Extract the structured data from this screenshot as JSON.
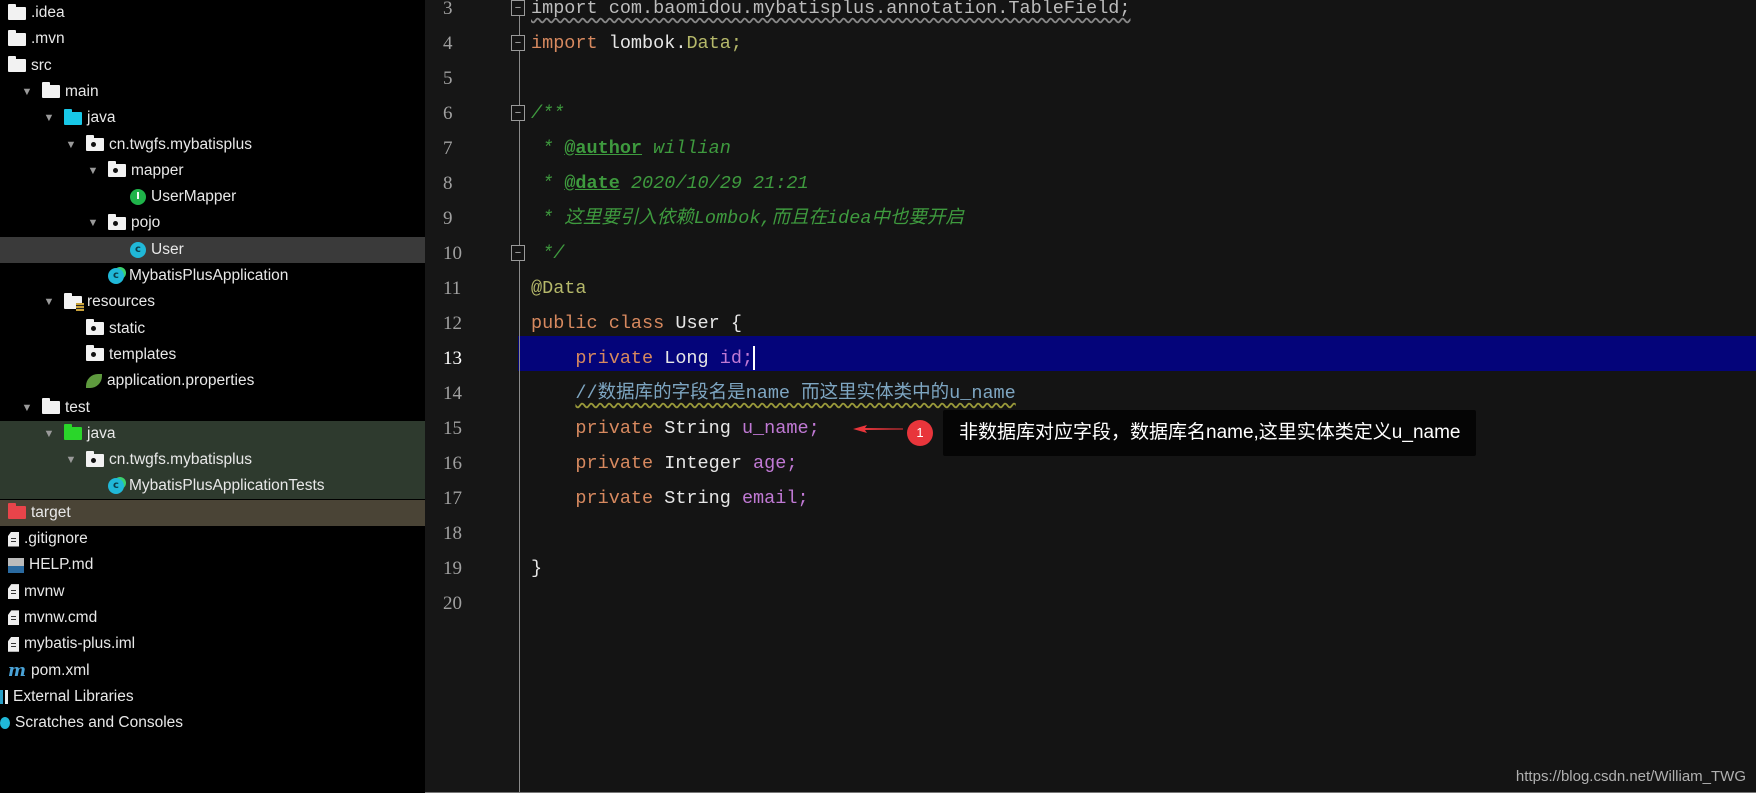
{
  "project_tree": {
    "items": [
      {
        "label": ".idea",
        "indent": 0,
        "toggle": "none",
        "icon": "folder-icon",
        "state": ""
      },
      {
        "label": ".mvn",
        "indent": 0,
        "toggle": "none",
        "icon": "folder-icon",
        "state": ""
      },
      {
        "label": "src",
        "indent": 0,
        "toggle": "none",
        "icon": "folder-icon",
        "state": ""
      },
      {
        "label": "main",
        "indent": 1,
        "toggle": "expanded",
        "icon": "folder-icon",
        "state": ""
      },
      {
        "label": "java",
        "indent": 2,
        "toggle": "expanded",
        "icon": "source-folder-icon",
        "state": ""
      },
      {
        "label": "cn.twgfs.mybatisplus",
        "indent": 3,
        "toggle": "expanded",
        "icon": "package-icon",
        "state": ""
      },
      {
        "label": "mapper",
        "indent": 4,
        "toggle": "expanded",
        "icon": "package-icon",
        "state": ""
      },
      {
        "label": "UserMapper",
        "indent": 5,
        "toggle": "none",
        "icon": "interface-icon",
        "state": ""
      },
      {
        "label": "pojo",
        "indent": 4,
        "toggle": "expanded",
        "icon": "package-icon",
        "state": ""
      },
      {
        "label": "User",
        "indent": 5,
        "toggle": "none",
        "icon": "class-icon",
        "state": "selected"
      },
      {
        "label": "MybatisPlusApplication",
        "indent": 4,
        "toggle": "none",
        "icon": "spring-boot-class-icon",
        "state": ""
      },
      {
        "label": "resources",
        "indent": 2,
        "toggle": "expanded",
        "icon": "resources-folder-icon",
        "state": ""
      },
      {
        "label": "static",
        "indent": 3,
        "toggle": "none",
        "icon": "package-icon",
        "state": ""
      },
      {
        "label": "templates",
        "indent": 3,
        "toggle": "none",
        "icon": "package-icon",
        "state": ""
      },
      {
        "label": "application.properties",
        "indent": 3,
        "toggle": "none",
        "icon": "spring-properties-icon",
        "state": ""
      },
      {
        "label": "test",
        "indent": 1,
        "toggle": "expanded",
        "icon": "folder-icon",
        "state": ""
      },
      {
        "label": "java",
        "indent": 2,
        "toggle": "expanded",
        "icon": "test-folder-icon",
        "state": "test"
      },
      {
        "label": "cn.twgfs.mybatisplus",
        "indent": 3,
        "toggle": "expanded",
        "icon": "package-icon",
        "state": "test"
      },
      {
        "label": "MybatisPlusApplicationTests",
        "indent": 4,
        "toggle": "none",
        "icon": "spring-boot-class-icon",
        "state": "test"
      },
      {
        "label": "target",
        "indent": 0,
        "toggle": "none",
        "icon": "excluded-folder-icon",
        "state": "excluded"
      },
      {
        "label": ".gitignore",
        "indent": 0,
        "toggle": "none",
        "icon": "text-file-icon",
        "state": ""
      },
      {
        "label": "HELP.md",
        "indent": 0,
        "toggle": "none",
        "icon": "markdown-file-icon",
        "state": ""
      },
      {
        "label": "mvnw",
        "indent": 0,
        "toggle": "none",
        "icon": "text-file-icon",
        "state": ""
      },
      {
        "label": "mvnw.cmd",
        "indent": 0,
        "toggle": "none",
        "icon": "text-file-icon",
        "state": ""
      },
      {
        "label": "mybatis-plus.iml",
        "indent": 0,
        "toggle": "none",
        "icon": "module-file-icon",
        "state": ""
      },
      {
        "label": "pom.xml",
        "indent": 0,
        "toggle": "none",
        "icon": "maven-icon",
        "state": ""
      },
      {
        "label": "External Libraries",
        "indent": -1,
        "toggle": "none",
        "icon": "external-libraries-icon",
        "state": ""
      },
      {
        "label": "Scratches and Consoles",
        "indent": -1,
        "toggle": "none",
        "icon": "scratches-icon",
        "state": ""
      }
    ]
  },
  "editor": {
    "current_line": 13,
    "lines": [
      {
        "n": "3",
        "tokens": [
          {
            "t": "import com.baomidou.mybatisplus.annotation.TableField;",
            "c": "unused"
          }
        ],
        "fold": "open"
      },
      {
        "n": "4",
        "tokens": [
          {
            "t": "import",
            "c": "kw"
          },
          {
            "t": " lombok.",
            "c": ""
          },
          {
            "t": "Data;",
            "c": "ann"
          }
        ],
        "fold": "close"
      },
      {
        "n": "5",
        "tokens": []
      },
      {
        "n": "6",
        "tokens": [
          {
            "t": "/**",
            "c": "cmt"
          }
        ],
        "fold": "open"
      },
      {
        "n": "7",
        "tokens": [
          {
            "t": " * ",
            "c": "cmt"
          },
          {
            "t": "@author",
            "c": "cmt-tag"
          },
          {
            "t": " willian",
            "c": "cmt"
          }
        ]
      },
      {
        "n": "8",
        "tokens": [
          {
            "t": " * ",
            "c": "cmt"
          },
          {
            "t": "@date",
            "c": "cmt-tag"
          },
          {
            "t": " 2020/10/29 21:21",
            "c": "cmt"
          }
        ]
      },
      {
        "n": "9",
        "tokens": [
          {
            "t": " * 这里要引入依赖Lombok,而且在idea中也要开启",
            "c": "cmt"
          }
        ]
      },
      {
        "n": "10",
        "tokens": [
          {
            "t": " */",
            "c": "cmt"
          }
        ],
        "fold": "close"
      },
      {
        "n": "11",
        "tokens": [
          {
            "t": "@Data",
            "c": "ann"
          }
        ]
      },
      {
        "n": "12",
        "tokens": [
          {
            "t": "public class",
            "c": "kw"
          },
          {
            "t": " User {",
            "c": ""
          }
        ]
      },
      {
        "n": "13",
        "tokens": [
          {
            "t": "    private",
            "c": "kw"
          },
          {
            "t": " Long ",
            "c": ""
          },
          {
            "t": "id;",
            "c": "fld"
          }
        ],
        "caret": true
      },
      {
        "n": "14",
        "tokens": [
          {
            "t": "    ",
            "c": ""
          },
          {
            "t": "//数据库的字段名是name 而这里实体类中的u_name",
            "c": "lcmt"
          }
        ]
      },
      {
        "n": "15",
        "tokens": [
          {
            "t": "    private",
            "c": "kw"
          },
          {
            "t": " String ",
            "c": ""
          },
          {
            "t": "u_name;",
            "c": "fld"
          }
        ]
      },
      {
        "n": "16",
        "tokens": [
          {
            "t": "    private",
            "c": "kw"
          },
          {
            "t": " Integer ",
            "c": ""
          },
          {
            "t": "age;",
            "c": "fld"
          }
        ]
      },
      {
        "n": "17",
        "tokens": [
          {
            "t": "    private",
            "c": "kw"
          },
          {
            "t": " String ",
            "c": ""
          },
          {
            "t": "email;",
            "c": "fld"
          }
        ]
      },
      {
        "n": "18",
        "tokens": []
      },
      {
        "n": "19",
        "tokens": [
          {
            "t": "}",
            "c": ""
          }
        ]
      },
      {
        "n": "20",
        "tokens": []
      }
    ]
  },
  "annotation": {
    "badge": "1",
    "text": "非数据库对应字段，数据库名name,这里实体类定义u_name",
    "color": "#e8353b"
  },
  "watermark": "https://blog.csdn.net/William_TWG"
}
